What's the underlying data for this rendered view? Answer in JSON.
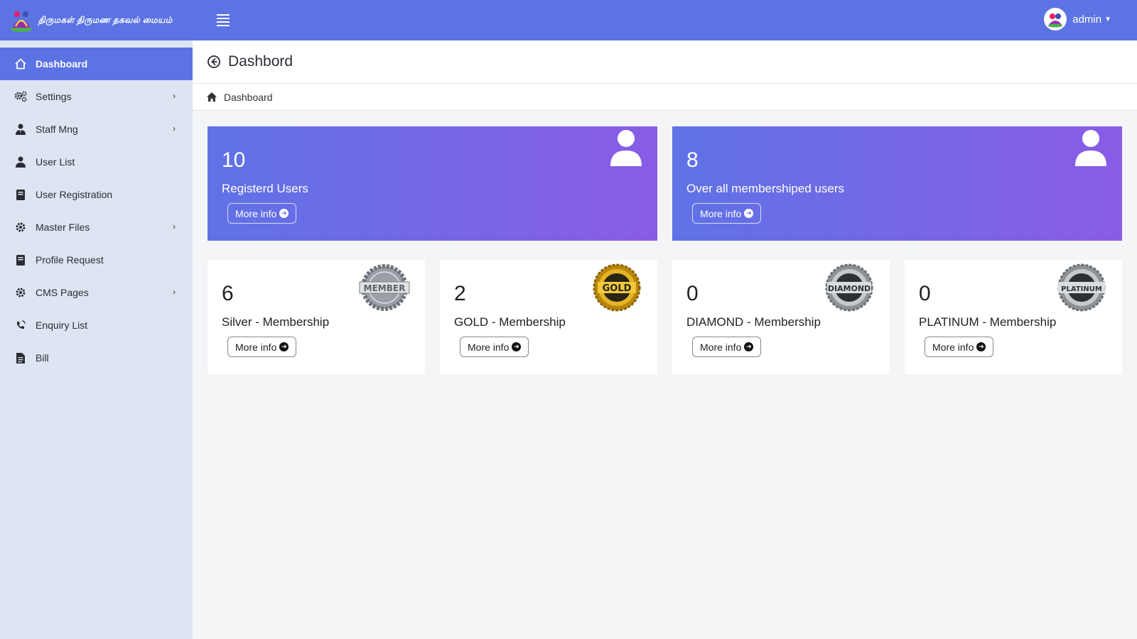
{
  "brand": {
    "title": "திருமகள் திருமண தகவல் மையம்"
  },
  "user": {
    "name": "admin"
  },
  "sidebar": {
    "items": [
      {
        "label": "Dashboard"
      },
      {
        "label": "Settings"
      },
      {
        "label": "Staff Mng"
      },
      {
        "label": "User List"
      },
      {
        "label": "User Registration"
      },
      {
        "label": "Master Files"
      },
      {
        "label": "Profile Request"
      },
      {
        "label": "CMS Pages"
      },
      {
        "label": "Enquiry List"
      },
      {
        "label": "Bill"
      }
    ]
  },
  "page": {
    "title": "Dashbord",
    "breadcrumb": "Dashboard"
  },
  "stats": [
    {
      "value": "10",
      "label": "Registerd Users",
      "more": "More info"
    },
    {
      "value": "8",
      "label": "Over all membershiped users",
      "more": "More info"
    }
  ],
  "memberships": [
    {
      "value": "6",
      "label": "Silver - Membership",
      "more": "More info",
      "badge_text": "MEMBER"
    },
    {
      "value": "2",
      "label": "GOLD - Membership",
      "more": "More info",
      "badge_text": "GOLD"
    },
    {
      "value": "0",
      "label": "DIAMOND - Membership",
      "more": "More info",
      "badge_text": "DIAMOND"
    },
    {
      "value": "0",
      "label": "PLATINUM - Membership",
      "more": "More info",
      "badge_text": "PLATINUM"
    }
  ],
  "colors": {
    "primary": "#5b73e3",
    "sidebar_bg": "#dde5f3",
    "gradient_end": "#8a5ce6"
  }
}
